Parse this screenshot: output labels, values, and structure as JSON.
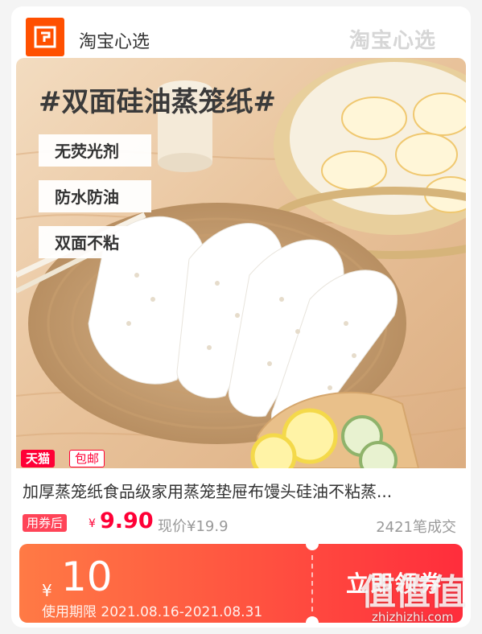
{
  "header": {
    "brand_name": "淘宝心选",
    "watermark_brand": "淘宝心选"
  },
  "image": {
    "headline": "#双面硅油蒸笼纸#",
    "features": [
      "无荧光剂",
      "防水防油",
      "双面不粘"
    ]
  },
  "badges": {
    "tmall": "天猫",
    "free_shipping": "包邮"
  },
  "product": {
    "title": "加厚蒸笼纸食品级家用蒸笼垫屉布馒头硅油不粘蒸...",
    "coupon_tag": "用券后",
    "currency": "¥",
    "price": "9.90",
    "original_price": "现价¥19.9",
    "sales": "2421笔成交"
  },
  "coupon": {
    "currency": "¥",
    "amount": "10",
    "validity": "使用期限 2021.08.16-2021.08.31",
    "button": "立即领券"
  },
  "watermark": {
    "site": "值值值",
    "url": "zhizhizhi.com"
  },
  "colors": {
    "brand_orange": "#ff5000",
    "price_red": "#ff0036",
    "coupon_gradient_start": "#ff7a45",
    "coupon_gradient_end": "#ff2d3c"
  }
}
